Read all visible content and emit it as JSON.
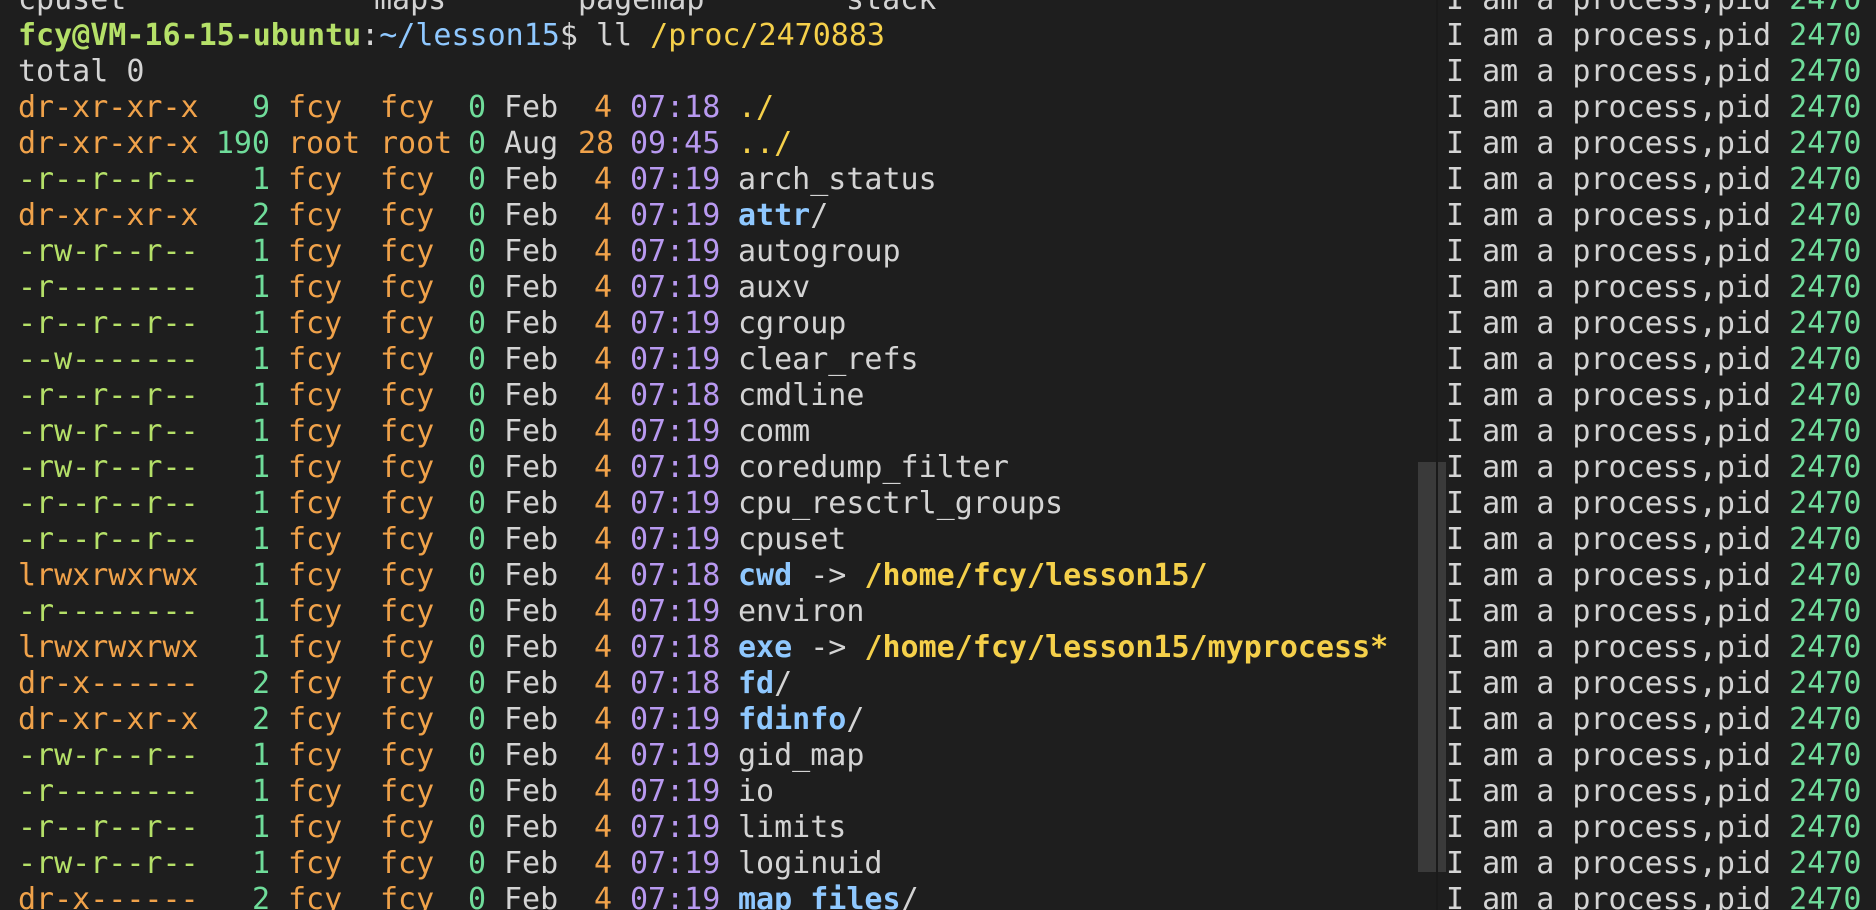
{
  "top_partial_line": {
    "col1": "cpuset",
    "col2": "maps",
    "col3": "pagemap",
    "col4": "stack"
  },
  "prompt": {
    "user_host": "fcy@VM-16-15-ubuntu",
    "separator": ":",
    "path": "~/lesson15",
    "symbol": "$",
    "command": "ll",
    "argument": "/proc/2470883"
  },
  "total_line": "total 0",
  "entries": [
    {
      "perm": "dr-xr-xr-x",
      "links": "9",
      "user": "fcy",
      "group": "fcy",
      "size": "0",
      "month": "Feb",
      "day": "4",
      "time": "07:18",
      "name": "./",
      "kind": "dotdir"
    },
    {
      "perm": "dr-xr-xr-x",
      "links": "190",
      "user": "root",
      "group": "root",
      "size": "0",
      "month": "Aug",
      "day": "28",
      "time": "09:45",
      "name": "../",
      "kind": "dotdir"
    },
    {
      "perm": "-r--r--r--",
      "links": "1",
      "user": "fcy",
      "group": "fcy",
      "size": "0",
      "month": "Feb",
      "day": "4",
      "time": "07:19",
      "name": "arch_status",
      "kind": "file"
    },
    {
      "perm": "dr-xr-xr-x",
      "links": "2",
      "user": "fcy",
      "group": "fcy",
      "size": "0",
      "month": "Feb",
      "day": "4",
      "time": "07:19",
      "name": "attr",
      "kind": "dir"
    },
    {
      "perm": "-rw-r--r--",
      "links": "1",
      "user": "fcy",
      "group": "fcy",
      "size": "0",
      "month": "Feb",
      "day": "4",
      "time": "07:19",
      "name": "autogroup",
      "kind": "file"
    },
    {
      "perm": "-r--------",
      "links": "1",
      "user": "fcy",
      "group": "fcy",
      "size": "0",
      "month": "Feb",
      "day": "4",
      "time": "07:19",
      "name": "auxv",
      "kind": "file"
    },
    {
      "perm": "-r--r--r--",
      "links": "1",
      "user": "fcy",
      "group": "fcy",
      "size": "0",
      "month": "Feb",
      "day": "4",
      "time": "07:19",
      "name": "cgroup",
      "kind": "file"
    },
    {
      "perm": "--w-------",
      "links": "1",
      "user": "fcy",
      "group": "fcy",
      "size": "0",
      "month": "Feb",
      "day": "4",
      "time": "07:19",
      "name": "clear_refs",
      "kind": "file"
    },
    {
      "perm": "-r--r--r--",
      "links": "1",
      "user": "fcy",
      "group": "fcy",
      "size": "0",
      "month": "Feb",
      "day": "4",
      "time": "07:18",
      "name": "cmdline",
      "kind": "file"
    },
    {
      "perm": "-rw-r--r--",
      "links": "1",
      "user": "fcy",
      "group": "fcy",
      "size": "0",
      "month": "Feb",
      "day": "4",
      "time": "07:19",
      "name": "comm",
      "kind": "file"
    },
    {
      "perm": "-rw-r--r--",
      "links": "1",
      "user": "fcy",
      "group": "fcy",
      "size": "0",
      "month": "Feb",
      "day": "4",
      "time": "07:19",
      "name": "coredump_filter",
      "kind": "file"
    },
    {
      "perm": "-r--r--r--",
      "links": "1",
      "user": "fcy",
      "group": "fcy",
      "size": "0",
      "month": "Feb",
      "day": "4",
      "time": "07:19",
      "name": "cpu_resctrl_groups",
      "kind": "file"
    },
    {
      "perm": "-r--r--r--",
      "links": "1",
      "user": "fcy",
      "group": "fcy",
      "size": "0",
      "month": "Feb",
      "day": "4",
      "time": "07:19",
      "name": "cpuset",
      "kind": "file"
    },
    {
      "perm": "lrwxrwxrwx",
      "links": "1",
      "user": "fcy",
      "group": "fcy",
      "size": "0",
      "month": "Feb",
      "day": "4",
      "time": "07:18",
      "name": "cwd",
      "kind": "link",
      "arrow": "->",
      "target": "/home/fcy/lesson15/"
    },
    {
      "perm": "-r--------",
      "links": "1",
      "user": "fcy",
      "group": "fcy",
      "size": "0",
      "month": "Feb",
      "day": "4",
      "time": "07:19",
      "name": "environ",
      "kind": "file"
    },
    {
      "perm": "lrwxrwxrwx",
      "links": "1",
      "user": "fcy",
      "group": "fcy",
      "size": "0",
      "month": "Feb",
      "day": "4",
      "time": "07:18",
      "name": "exe",
      "kind": "link",
      "arrow": "->",
      "target": "/home/fcy/lesson15/myprocess*"
    },
    {
      "perm": "dr-x------",
      "links": "2",
      "user": "fcy",
      "group": "fcy",
      "size": "0",
      "month": "Feb",
      "day": "4",
      "time": "07:18",
      "name": "fd",
      "kind": "dir"
    },
    {
      "perm": "dr-xr-xr-x",
      "links": "2",
      "user": "fcy",
      "group": "fcy",
      "size": "0",
      "month": "Feb",
      "day": "4",
      "time": "07:19",
      "name": "fdinfo",
      "kind": "dir"
    },
    {
      "perm": "-rw-r--r--",
      "links": "1",
      "user": "fcy",
      "group": "fcy",
      "size": "0",
      "month": "Feb",
      "day": "4",
      "time": "07:19",
      "name": "gid_map",
      "kind": "file"
    },
    {
      "perm": "-r--------",
      "links": "1",
      "user": "fcy",
      "group": "fcy",
      "size": "0",
      "month": "Feb",
      "day": "4",
      "time": "07:19",
      "name": "io",
      "kind": "file"
    },
    {
      "perm": "-r--r--r--",
      "links": "1",
      "user": "fcy",
      "group": "fcy",
      "size": "0",
      "month": "Feb",
      "day": "4",
      "time": "07:19",
      "name": "limits",
      "kind": "file"
    },
    {
      "perm": "-rw-r--r--",
      "links": "1",
      "user": "fcy",
      "group": "fcy",
      "size": "0",
      "month": "Feb",
      "day": "4",
      "time": "07:19",
      "name": "loginuid",
      "kind": "file"
    },
    {
      "perm": "dr-x------",
      "links": "2",
      "user": "fcy",
      "group": "fcy",
      "size": "0",
      "month": "Feb",
      "day": "4",
      "time": "07:19",
      "name": "map_files",
      "kind": "dir"
    }
  ],
  "right_pane": {
    "text": "I am a process,pid ",
    "pid": "2470",
    "line_count": 26
  },
  "colors": {
    "background": "#1e1e1e",
    "perm": "#f0a24a",
    "links": "#6fdc9a",
    "time": "#b899f0",
    "dir": "#8fc8ff",
    "link_target": "#f5d04a",
    "prompt_user": "#b5e068"
  }
}
